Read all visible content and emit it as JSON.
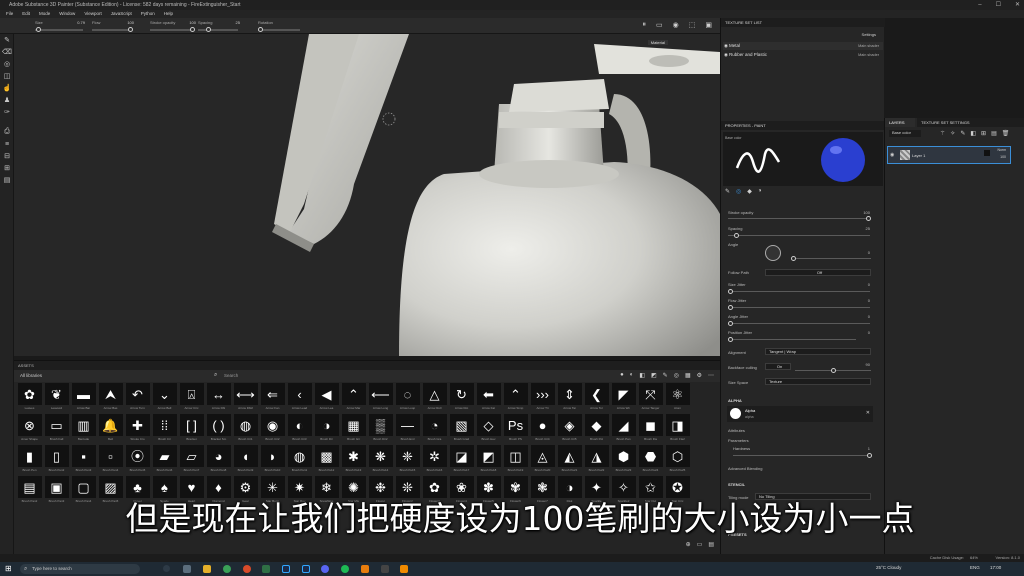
{
  "window": {
    "title": "Adobe Substance 3D Painter (Substance Edition) - License: 582 days remaining - FireExtinguisher_Start"
  },
  "menu": [
    "File",
    "Edit",
    "Mode",
    "Window",
    "Viewport",
    "JavaScript",
    "Python",
    "Help"
  ],
  "toolbar": {
    "size_label": "Size",
    "size_value": "0.79",
    "flow_label": "Flow",
    "flow_value": "100",
    "stroke_opacity_label": "Stroke opacity",
    "stroke_opacity_value": "100",
    "spacing_label": "Spacing",
    "spacing_value": "25",
    "rotation_label": "Rotation"
  },
  "viewport": {
    "matcap_label": "Material"
  },
  "assets": {
    "title": "ASSETS",
    "breadcrumb": "All libraries",
    "search_placeholder": "Search",
    "items": [
      {
        "g": "✿",
        "n": "Leaves"
      },
      {
        "g": "❦",
        "n": "Leaves2"
      },
      {
        "g": "▬",
        "n": "Arrow Bar"
      },
      {
        "g": "⮝",
        "n": "Arrow Bas"
      },
      {
        "g": "↶",
        "n": "Arrow Turn"
      },
      {
        "g": "⌄",
        "n": "Arrow Bell"
      },
      {
        "g": "⍓",
        "n": "Arrow Circ"
      },
      {
        "g": "↔",
        "n": "Arrow Dbl"
      },
      {
        "g": "⟷",
        "n": "Arrow Dbl2"
      },
      {
        "g": "⇐",
        "n": "Arrow Fan"
      },
      {
        "g": "‹",
        "n": "Arrow Lead"
      },
      {
        "g": "◀",
        "n": "Arrow Lea"
      },
      {
        "g": "⌃",
        "n": "Arrow Mar"
      },
      {
        "g": "⟵",
        "n": "Arrow Long"
      },
      {
        "g": "◌",
        "n": "Arrow Loop"
      },
      {
        "g": "△",
        "n": "Arrow Roll"
      },
      {
        "g": "↻",
        "n": "Arrow Rot"
      },
      {
        "g": "⬅",
        "n": "Arrow Fat"
      },
      {
        "g": "⌃",
        "n": "Arrow Simp"
      },
      {
        "g": "›››",
        "n": "Arrow Tri"
      },
      {
        "g": "⇕",
        "n": "Arrow Tai"
      },
      {
        "g": "❮",
        "n": "Arrow Tor"
      },
      {
        "g": "◤",
        "n": "Arrow Wn"
      },
      {
        "g": "⤧",
        "n": "Arrow Tanger"
      },
      {
        "g": "⚛",
        "n": "Atom"
      },
      {
        "g": "⊗",
        "n": "Amer Shape"
      },
      {
        "g": "▭",
        "n": "Brush Fall"
      },
      {
        "g": "▥",
        "n": "Barcode"
      },
      {
        "g": "🔔",
        "n": "Bell"
      },
      {
        "g": "✚",
        "n": "Stroke Cro"
      },
      {
        "g": "⁞⁞",
        "n": "Brush Cir"
      },
      {
        "g": "[ ]",
        "n": "Bracket"
      },
      {
        "g": "( )",
        "n": "Bracket Sm"
      },
      {
        "g": "◍",
        "n": "Brush Cir1"
      },
      {
        "g": "◉",
        "n": "Brush Cir2"
      },
      {
        "g": "◐",
        "n": "Brush Cir3"
      },
      {
        "g": "◑",
        "n": "Brush Dir"
      },
      {
        "g": "▦",
        "n": "Brush Gri"
      },
      {
        "g": "▒",
        "n": "Brush Dir2"
      },
      {
        "g": "—",
        "n": "Brush Eml"
      },
      {
        "g": "◔",
        "n": "Brush Gra"
      },
      {
        "g": "▧",
        "n": "Brush Gra2"
      },
      {
        "g": "◇",
        "n": "Brush Hev"
      },
      {
        "g": "Ps",
        "n": "Brush PS"
      },
      {
        "g": "●",
        "n": "Brush Cir4"
      },
      {
        "g": "◈",
        "n": "Brush Cir5"
      },
      {
        "g": "◆",
        "n": "Brush Pol"
      },
      {
        "g": "◢",
        "n": "Brush Pan"
      },
      {
        "g": "◼",
        "n": "Brush Fla"
      },
      {
        "g": "◨",
        "n": "Brush Fla2"
      },
      {
        "g": "▮",
        "n": "Brush Pen"
      },
      {
        "g": "▯",
        "n": "Brush Pen2"
      },
      {
        "g": "▪",
        "n": "Brush Pen3"
      },
      {
        "g": "▫",
        "n": "Brush Pen4"
      },
      {
        "g": "⦿",
        "n": "Brush Pen5"
      },
      {
        "g": "▰",
        "n": "Brush Pen6"
      },
      {
        "g": "▱",
        "n": "Brush Pen7"
      },
      {
        "g": "◕",
        "n": "Brush Pen8"
      },
      {
        "g": "◖",
        "n": "Brush Pen9"
      },
      {
        "g": "◗",
        "n": "Brush Pe10"
      },
      {
        "g": "◍",
        "n": "Brush Pe11"
      },
      {
        "g": "▩",
        "n": "Brush Pe12"
      },
      {
        "g": "✱",
        "n": "Brush Pe13"
      },
      {
        "g": "❋",
        "n": "Brush Pe14"
      },
      {
        "g": "❈",
        "n": "Brush Pe15"
      },
      {
        "g": "✲",
        "n": "Brush Pe16"
      },
      {
        "g": "◪",
        "n": "Brush Pe17"
      },
      {
        "g": "◩",
        "n": "Brush Pe18"
      },
      {
        "g": "◫",
        "n": "Brush Pe19"
      },
      {
        "g": "◬",
        "n": "Brush Pe20"
      },
      {
        "g": "◭",
        "n": "Brush Pe21"
      },
      {
        "g": "◮",
        "n": "Brush Pe22"
      },
      {
        "g": "⬢",
        "n": "Brush Pe23"
      },
      {
        "g": "⬣",
        "n": "Brush Pe24"
      },
      {
        "g": "⬡",
        "n": "Brush Pe25"
      },
      {
        "g": "▤",
        "n": "Brush Pan2"
      },
      {
        "g": "▣",
        "n": "Brush Pan3"
      },
      {
        "g": "▢",
        "n": "Brush Pan4"
      },
      {
        "g": "▨",
        "n": "Brush Pan5"
      },
      {
        "g": "♣",
        "n": "Clover"
      },
      {
        "g": "♠",
        "n": "Spade"
      },
      {
        "g": "♥",
        "n": "Heart"
      },
      {
        "g": "♦",
        "n": "Diamond"
      },
      {
        "g": "⚙",
        "n": "Gear"
      },
      {
        "g": "✳",
        "n": "Star Burst"
      },
      {
        "g": "✷",
        "n": "Star Ray"
      },
      {
        "g": "❄",
        "n": "Snowflake"
      },
      {
        "g": "✺",
        "n": "Star Mix"
      },
      {
        "g": "❉",
        "n": "Flower"
      },
      {
        "g": "❊",
        "n": "Flower2"
      },
      {
        "g": "✿",
        "n": "Flower3"
      },
      {
        "g": "❀",
        "n": "Flower4"
      },
      {
        "g": "✽",
        "n": "Flower5"
      },
      {
        "g": "✾",
        "n": "Flower6"
      },
      {
        "g": "❃",
        "n": "Flower7"
      },
      {
        "g": "◑",
        "n": "Disk"
      },
      {
        "g": "✦",
        "n": "Sparkle"
      },
      {
        "g": "✧",
        "n": "Sparkle2"
      },
      {
        "g": "✩",
        "n": "Star Out"
      },
      {
        "g": "✪",
        "n": "Star Circ"
      }
    ]
  },
  "texture_set_list": {
    "title": "TEXTURE SET LIST",
    "settings": "Settings",
    "rows": [
      {
        "name": "Metal",
        "shader": "Main shader"
      },
      {
        "name": "Rubber and Plastic",
        "shader": "Main shader"
      }
    ]
  },
  "properties": {
    "title": "PROPERTIES - PAINT",
    "base_color": "Base color",
    "stroke_opacity": {
      "label": "Stroke opacity",
      "value": "100"
    },
    "spacing": {
      "label": "Spacing",
      "value": "25"
    },
    "angle": {
      "label": "Angle",
      "value": "0"
    },
    "follow_path": {
      "label": "Follow Path",
      "value": "Off"
    },
    "size_jitter": {
      "label": "Size Jitter",
      "value": "0"
    },
    "flow_jitter": {
      "label": "Flow Jitter",
      "value": "0"
    },
    "angle_jitter": {
      "label": "Angle Jitter",
      "value": "0"
    },
    "position_jitter": {
      "label": "Position Jitter",
      "value": "0"
    },
    "alignment": {
      "label": "Alignment",
      "value": "Tangent | Wrap"
    },
    "backface_culling": {
      "label": "Backface culling",
      "value": "On",
      "number": "90"
    },
    "size_space": {
      "label": "Size Space",
      "value": "Texture"
    },
    "alpha_section": "ALPHA",
    "alpha_name": "Alpha",
    "alpha_type": "alpha",
    "attributes": "Attributes",
    "parameters": "Parameters",
    "hardness": "Hardness",
    "hardness_value": "1",
    "advanced_blending": "Advanced Blending",
    "stencil_section": "STENCIL",
    "tiling_mode": "Tiling mode",
    "tiling_value": "No Tiling",
    "presets": "PRESETS"
  },
  "layers": {
    "tab": "LAYERS",
    "tab2": "TEXTURE SET SETTINGS",
    "layer_name": "Layer 1",
    "blend": "Norm",
    "opacity": "100"
  },
  "status": {
    "cache": "Cache Disk Usage:",
    "cache_value": "64%",
    "version": "Version: 8.1.0"
  },
  "taskbar": {
    "search_placeholder": "Type here to search",
    "weather": "25°C  Cloudy",
    "lang": "ENG",
    "time": "17:00"
  },
  "subtitle": "但是现在让我们把硬度设为100笔刷的大小设为小一点",
  "colors": {
    "accent": "#3b8fd8",
    "bg": "#262626",
    "sphere": "#2a3fd0"
  }
}
